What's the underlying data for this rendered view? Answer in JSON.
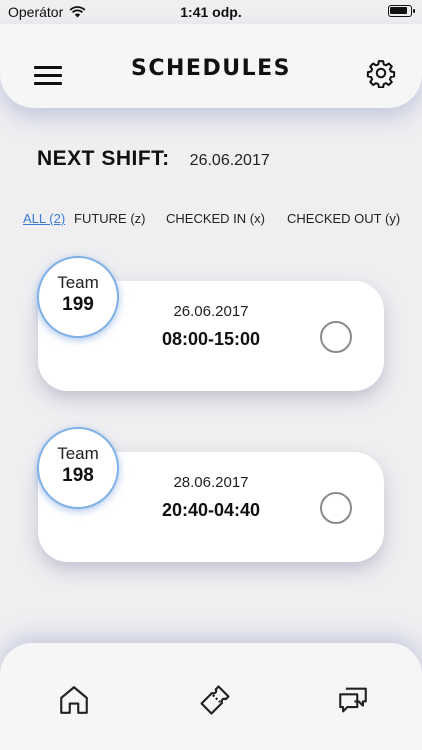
{
  "status_bar": {
    "carrier": "Operátor",
    "time": "1:41 odp."
  },
  "header": {
    "title": "SCHEDULES",
    "menu_icon": "hamburger-menu-icon",
    "settings_icon": "gear-icon"
  },
  "next_shift": {
    "label": "NEXT SHIFT:",
    "date": "26.06.2017"
  },
  "filters": [
    {
      "label": "ALL (2)",
      "active": true
    },
    {
      "label": "FUTURE (z)",
      "active": false
    },
    {
      "label": "CHECKED IN (x)",
      "active": false
    },
    {
      "label": "CHECKED OUT (y)",
      "active": false
    }
  ],
  "shifts": [
    {
      "team_label": "Team",
      "team_number": "199",
      "date": "26.06.2017",
      "time": "08:00-15:00",
      "checked": false
    },
    {
      "team_label": "Team",
      "team_number": "198",
      "date": "28.06.2017",
      "time": "20:40-04:40",
      "checked": false
    }
  ],
  "tabbar": {
    "icons": [
      "home-icon",
      "ticket-icon",
      "chat-icon"
    ]
  },
  "colors": {
    "accent": "#3b7bd3",
    "badge_border": "#7fb0e6",
    "background": "#efeff1"
  }
}
